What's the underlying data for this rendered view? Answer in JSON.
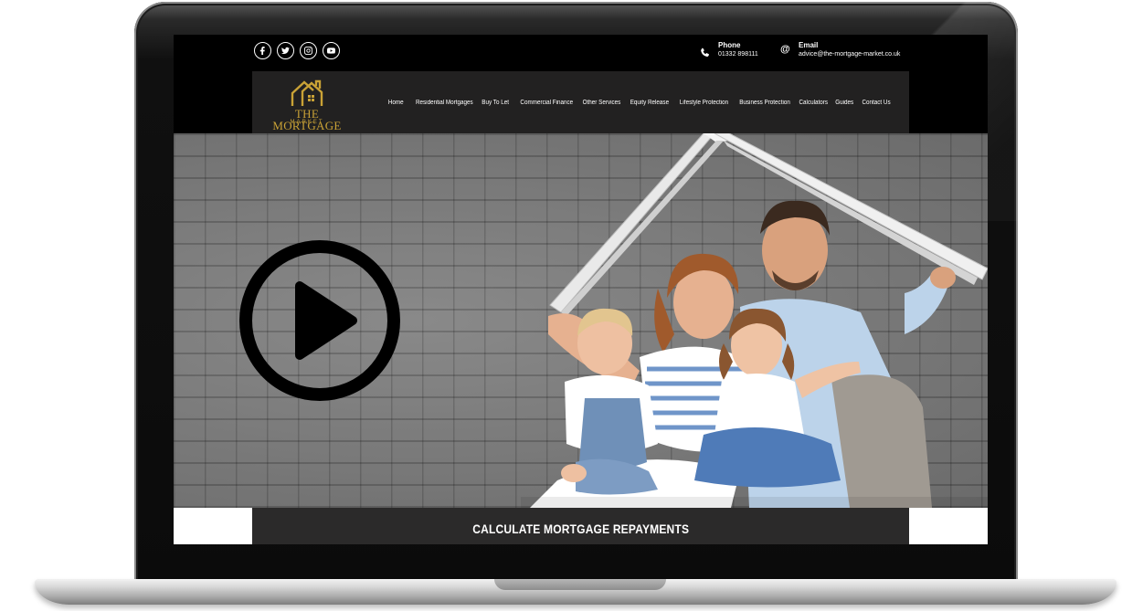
{
  "social": {
    "items": [
      {
        "name": "facebook",
        "icon": "facebook-icon"
      },
      {
        "name": "twitter",
        "icon": "twitter-icon"
      },
      {
        "name": "instagram",
        "icon": "instagram-icon"
      },
      {
        "name": "youtube",
        "icon": "youtube-icon"
      }
    ]
  },
  "contact": {
    "phone_label": "Phone",
    "phone_value": "01332 898111",
    "email_label": "Email",
    "email_value": "advice@the-mortgage-market.co.uk"
  },
  "logo": {
    "brand": "THE MORTGAGE",
    "sub": "MARKET",
    "color": "#c9a236"
  },
  "nav": {
    "items": [
      "Home",
      "Residential Mortgages",
      "Buy To Let",
      "Commercial Finance",
      "Other Services",
      "Equity Release",
      "Lifestyle Protection",
      "Business Protection",
      "Calculators",
      "Guides",
      "Contact Us"
    ]
  },
  "hero": {
    "play_icon": "play-icon",
    "image": "family-under-roof-photo"
  },
  "cta": {
    "label": "CALCULATE MORTGAGE REPAYMENTS"
  }
}
